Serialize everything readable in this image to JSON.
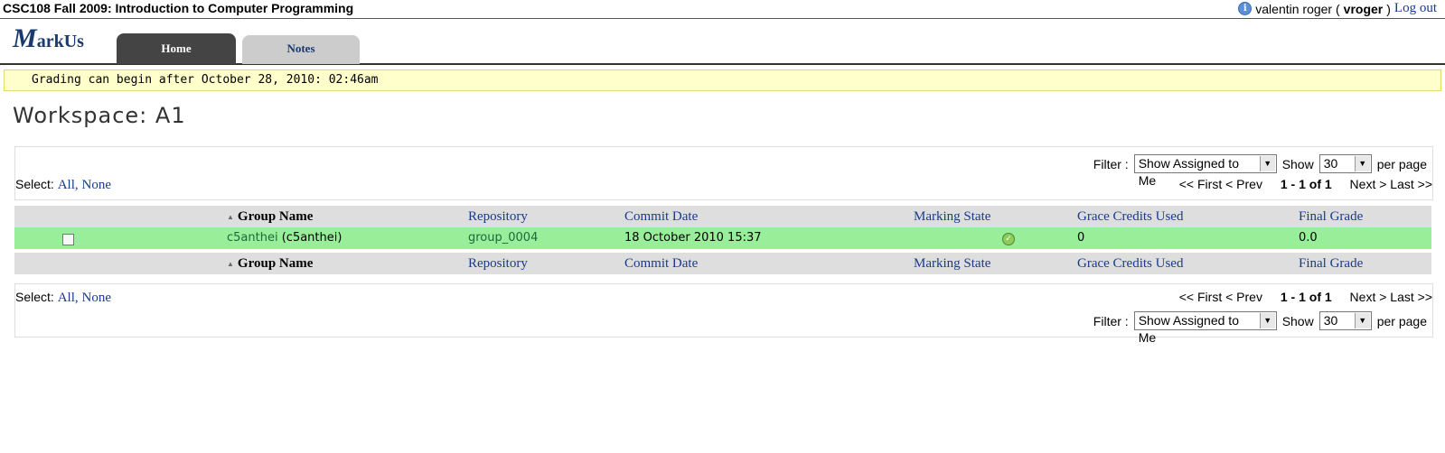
{
  "topbar": {
    "course_title": "CSC108 Fall 2009: Introduction to Computer Programming",
    "user_fullname": "valentin roger (",
    "user_id": "vroger",
    "close_paren": ")",
    "logout": "Log out"
  },
  "header": {
    "logo_m": "M",
    "logo_rest": "arkUs",
    "tabs": [
      {
        "label": "Home",
        "active": true
      },
      {
        "label": "Notes",
        "active": false
      }
    ]
  },
  "notice": "Grading can begin after October 28, 2010: 02:46am",
  "page_title": "Workspace: A1",
  "controls": {
    "filter_label": "Filter :",
    "filter_value": "Show Assigned to Me",
    "show_label": "Show",
    "per_page_value": "30",
    "per_page_label": "per page",
    "select_label": "Select:",
    "select_all": "All,",
    "select_none": "None",
    "pager_first": "<< First",
    "pager_prev": "< Prev",
    "pager_count": "1 - 1 of 1",
    "pager_next": "Next >",
    "pager_last": "Last >>"
  },
  "table": {
    "columns": [
      "Group Name",
      "Repository",
      "Commit Date",
      "Marking State",
      "Grace Credits Used",
      "Final Grade"
    ],
    "rows": [
      {
        "group_link": "c5anthei",
        "group_members": "(c5anthei)",
        "repository": "group_0004",
        "commit_date": "18 October 2010 15:37",
        "marking_state": "complete",
        "grace_credits": "0",
        "final_grade": "0.0"
      }
    ]
  },
  "colors": {
    "row_highlight": "#99ee99",
    "header_row": "#dedede",
    "active_tab": "#444444",
    "link": "#1a3a8a",
    "notice_bg": "#ffffcc"
  }
}
